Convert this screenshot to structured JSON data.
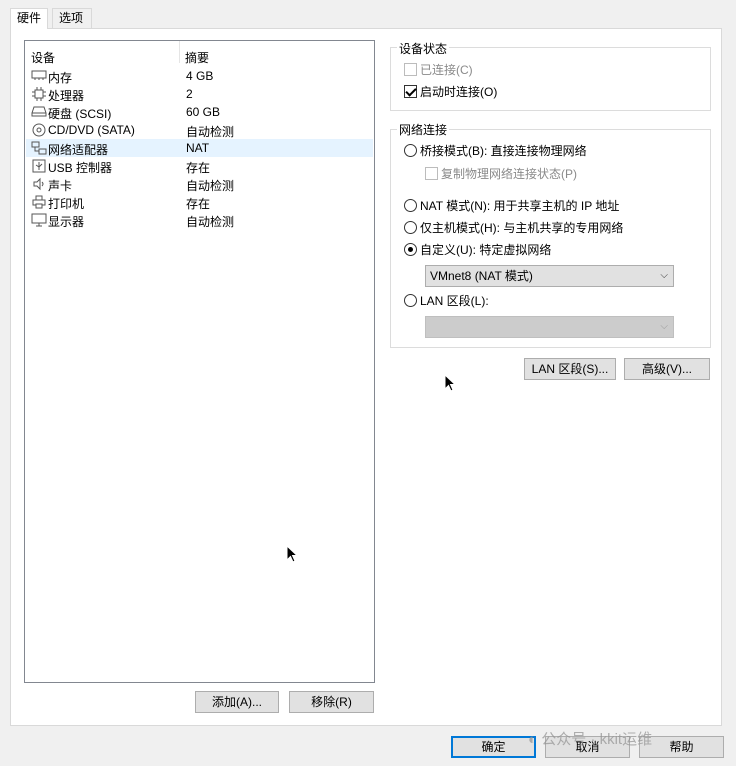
{
  "tabs": [
    {
      "label": "硬件",
      "active": true
    },
    {
      "label": "选项",
      "active": false
    }
  ],
  "device_list": {
    "headers": [
      "设备",
      "摘要"
    ],
    "rows": [
      {
        "icon": "memory-icon",
        "name": "内存",
        "summary": "4 GB"
      },
      {
        "icon": "processor-icon",
        "name": "处理器",
        "summary": "2"
      },
      {
        "icon": "harddisk-icon",
        "name": "硬盘 (SCSI)",
        "summary": "60 GB"
      },
      {
        "icon": "cd-dvd-icon",
        "name": "CD/DVD (SATA)",
        "summary": "自动检测"
      },
      {
        "icon": "network-adapter-icon",
        "name": "网络适配器",
        "summary": "NAT",
        "selected": true
      },
      {
        "icon": "usb-icon",
        "name": "USB 控制器",
        "summary": "存在"
      },
      {
        "icon": "sound-icon",
        "name": "声卡",
        "summary": "自动检测"
      },
      {
        "icon": "printer-icon",
        "name": "打印机",
        "summary": "存在"
      },
      {
        "icon": "display-icon",
        "name": "显示器",
        "summary": "自动检测"
      }
    ]
  },
  "list_buttons": {
    "add": "添加(A)...",
    "remove": "移除(R)"
  },
  "device_status": {
    "title": "设备状态",
    "connected": {
      "label": "已连接(C)",
      "checked": false,
      "disabled": true
    },
    "connect_on_power": {
      "label": "启动时连接(O)",
      "checked": true
    }
  },
  "network": {
    "title": "网络连接",
    "bridged": {
      "label": "桥接模式(B): 直接连接物理网络",
      "checked": false
    },
    "replicate": {
      "label": "复制物理网络连接状态(P)",
      "disabled": true
    },
    "nat": {
      "label": "NAT 模式(N): 用于共享主机的 IP 地址",
      "checked": false
    },
    "host_only": {
      "label": "仅主机模式(H): 与主机共享的专用网络",
      "checked": false
    },
    "custom": {
      "label": "自定义(U): 特定虚拟网络",
      "checked": true
    },
    "custom_select": "VMnet8 (NAT 模式)",
    "lan_segment": {
      "label": "LAN 区段(L):",
      "checked": false
    },
    "lan_select": ""
  },
  "net_buttons": {
    "lan_segments": "LAN 区段(S)...",
    "advanced": "高级(V)..."
  },
  "dialog_buttons": {
    "ok": "确定",
    "cancel": "取消",
    "help": "帮助"
  },
  "watermark": "公众号 · kkit运维"
}
